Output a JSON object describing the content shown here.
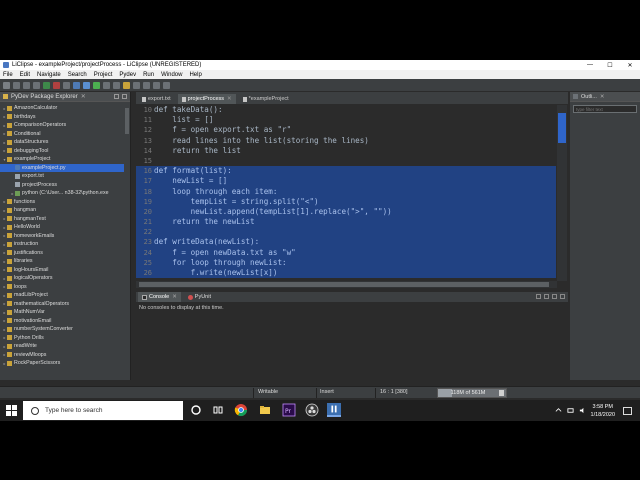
{
  "window": {
    "title": "LiClipse - exampleProject/projectProcess - LiClipse (UNREGISTERED)",
    "minimize": "—",
    "maximize": "☐",
    "close": "✕"
  },
  "menu": [
    "File",
    "Edit",
    "Navigate",
    "Search",
    "Project",
    "Pydev",
    "Run",
    "Window",
    "Help"
  ],
  "explorer": {
    "title": "PyDev Package Explorer",
    "close": "✕",
    "items": [
      {
        "label": "AmazonCalculator",
        "icon": "folder",
        "indent": 0,
        "twisty": "▸"
      },
      {
        "label": "birthdays",
        "icon": "folder",
        "indent": 0,
        "twisty": "▸"
      },
      {
        "label": "ComparisonOperators",
        "icon": "folder",
        "indent": 0,
        "twisty": "▸"
      },
      {
        "label": "Conditional",
        "icon": "folder",
        "indent": 0,
        "twisty": "▸"
      },
      {
        "label": "dataStructures",
        "icon": "folder",
        "indent": 0,
        "twisty": "▸"
      },
      {
        "label": "debuggingTool",
        "icon": "folder",
        "indent": 0,
        "twisty": "▸"
      },
      {
        "label": "exampleProject",
        "icon": "folder",
        "indent": 0,
        "twisty": "▾"
      },
      {
        "label": "exampleProject.py",
        "icon": "pyfile",
        "indent": 1,
        "twisty": "",
        "selected": true
      },
      {
        "label": "export.txt",
        "icon": "txt",
        "indent": 1,
        "twisty": ""
      },
      {
        "label": "projectProcess",
        "icon": "txt",
        "indent": 1,
        "twisty": ""
      },
      {
        "label": "python  (C:\\User...  n38-32\\python.exe",
        "icon": "lib",
        "indent": 1,
        "twisty": "▸"
      },
      {
        "label": "functions",
        "icon": "folder",
        "indent": 0,
        "twisty": "▸"
      },
      {
        "label": "hangman",
        "icon": "folder",
        "indent": 0,
        "twisty": "▸"
      },
      {
        "label": "hangmanTest",
        "icon": "folder",
        "indent": 0,
        "twisty": "▸"
      },
      {
        "label": "HelloWorld",
        "icon": "folder",
        "indent": 0,
        "twisty": "▸"
      },
      {
        "label": "homeworkEmails",
        "icon": "folder",
        "indent": 0,
        "twisty": "▸"
      },
      {
        "label": "instruction",
        "icon": "folder",
        "indent": 0,
        "twisty": "▸"
      },
      {
        "label": "justifications",
        "icon": "folder",
        "indent": 0,
        "twisty": "▸"
      },
      {
        "label": "libraries",
        "icon": "folder",
        "indent": 0,
        "twisty": "▸"
      },
      {
        "label": "logHoursEmail",
        "icon": "folder",
        "indent": 0,
        "twisty": "▸"
      },
      {
        "label": "logicalOperators",
        "icon": "folder",
        "indent": 0,
        "twisty": "▸"
      },
      {
        "label": "loops",
        "icon": "folder",
        "indent": 0,
        "twisty": "▸"
      },
      {
        "label": "madLibProject",
        "icon": "folder",
        "indent": 0,
        "twisty": "▸"
      },
      {
        "label": "mathematicalOperators",
        "icon": "folder",
        "indent": 0,
        "twisty": "▸"
      },
      {
        "label": "MathNumVar",
        "icon": "folder",
        "indent": 0,
        "twisty": "▸"
      },
      {
        "label": "motivationEmail",
        "icon": "folder",
        "indent": 0,
        "twisty": "▸"
      },
      {
        "label": "numberSystemConverter",
        "icon": "folder",
        "indent": 0,
        "twisty": "▸"
      },
      {
        "label": "Python Drills",
        "icon": "folder",
        "indent": 0,
        "twisty": "▸"
      },
      {
        "label": "readWrite",
        "icon": "folder",
        "indent": 0,
        "twisty": "▸"
      },
      {
        "label": "reviewMloops",
        "icon": "folder",
        "indent": 0,
        "twisty": "▸"
      },
      {
        "label": "RockPaperScissors",
        "icon": "folder",
        "indent": 0,
        "twisty": "▸"
      }
    ]
  },
  "editor": {
    "tabs": [
      {
        "label": "export.txt",
        "active": false
      },
      {
        "label": "projectProcess",
        "active": true
      },
      {
        "label": "*exampleProject",
        "active": false
      }
    ],
    "tab_close": "✕",
    "lines": [
      {
        "num": "10",
        "text": "def takeData():",
        "selected": false
      },
      {
        "num": "11",
        "text": "    list = []",
        "selected": false
      },
      {
        "num": "12",
        "text": "    f = open export.txt as \"r\"",
        "selected": false
      },
      {
        "num": "13",
        "text": "    read lines into the list(storing the lines)",
        "selected": false
      },
      {
        "num": "14",
        "text": "    return the list",
        "selected": false
      },
      {
        "num": "15",
        "text": "",
        "selected": false
      },
      {
        "num": "16",
        "text": "def format(list):",
        "selected": true
      },
      {
        "num": "17",
        "text": "    newList = []",
        "selected": true
      },
      {
        "num": "18",
        "text": "    loop through each item:",
        "selected": true
      },
      {
        "num": "19",
        "text": "        tempList = string.split(\"<\")",
        "selected": true
      },
      {
        "num": "20",
        "text": "        newList.append(tempList[1].replace(\">\", \"\"))",
        "selected": true
      },
      {
        "num": "21",
        "text": "    return the newList",
        "selected": true
      },
      {
        "num": "22",
        "text": "",
        "selected": true
      },
      {
        "num": "23",
        "text": "def writeData(newList):",
        "selected": true
      },
      {
        "num": "24",
        "text": "    f = open newData.txt as \"w\"",
        "selected": true
      },
      {
        "num": "25",
        "text": "    for loop through newList:",
        "selected": true
      },
      {
        "num": "26",
        "text": "        f.write(newList[x])",
        "selected": true
      }
    ]
  },
  "outline": {
    "title": "Outli...",
    "close": "✕",
    "filter_placeholder": "type filter text"
  },
  "console": {
    "tabs": [
      {
        "label": "Console",
        "active": true
      },
      {
        "label": "PyUnit",
        "active": false
      }
    ],
    "tab_close": "✕",
    "message": "No consoles to display at this time."
  },
  "status": {
    "writable": "Writable",
    "insert": "Insert",
    "position": "16 : 1 [380]",
    "heap": "118M of 561M",
    "heap_fraction": 0.21
  },
  "taskbar": {
    "search_placeholder": "Type here to search",
    "time": "3:58 PM",
    "date": "1/18/2020"
  },
  "colors": {
    "selection": "#214283",
    "accent": "#2f65ca"
  }
}
